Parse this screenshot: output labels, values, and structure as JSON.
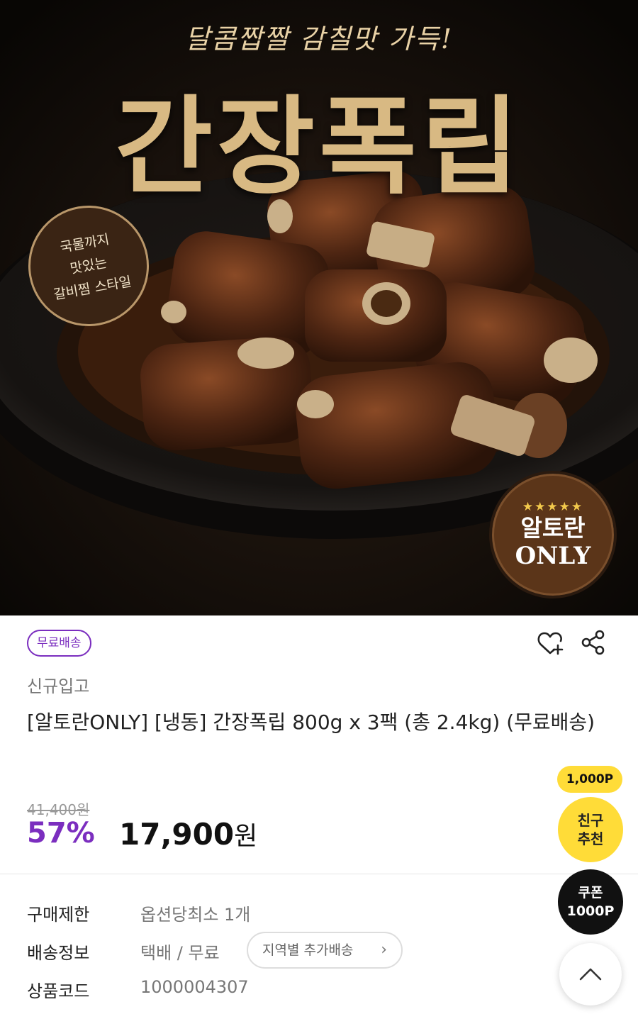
{
  "hero": {
    "subtitle": "달콤짭짤 감칠맛 가득!",
    "title": "간장폭립",
    "badge_left": [
      "국물까지",
      "맛있는",
      "갈비찜 스타일"
    ],
    "badge_right": {
      "stars": "★★★★★",
      "line1": "알토란",
      "line2": "ONLY"
    }
  },
  "product": {
    "free_shipping_tag": "무료배송",
    "new_label": "신규입고",
    "title": "[알토란ONLY] [냉동] 간장폭립 800g x 3팩 (총 2.4kg) (무료배송)",
    "original_price": "41,400원",
    "discount": "57%",
    "price_number": "17,900",
    "price_unit": "원"
  },
  "info": {
    "purchase_limit": {
      "label": "구매제한",
      "value": "옵션당최소 1개"
    },
    "shipping": {
      "label": "배송정보",
      "value": "택배 / 무료",
      "button": "지역별 추가배송"
    },
    "product_code": {
      "label": "상품코드",
      "value": "1000004307"
    }
  },
  "floating": {
    "points_tag": "1,000P",
    "friend_line1": "친구",
    "friend_line2": "추천",
    "coupon_line1": "쿠폰",
    "coupon_line2": "1000P"
  },
  "colors": {
    "accent": "#7b2ebf",
    "yellow": "#ffdc38"
  },
  "icons": [
    "heart-plus-icon",
    "share-icon",
    "chevron-right-icon",
    "chevron-up-icon"
  ]
}
